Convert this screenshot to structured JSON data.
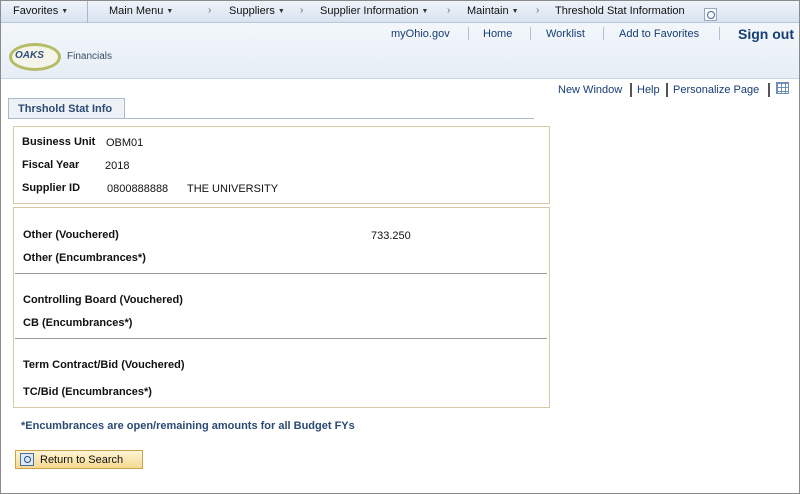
{
  "nav": {
    "favorites": "Favorites",
    "main_menu": "Main Menu",
    "breadcrumbs": [
      "Suppliers",
      "Supplier Information",
      "Maintain",
      "Threshold Stat Information"
    ],
    "dropdown_glyph": "▼",
    "arrow_glyph": "›"
  },
  "header": {
    "logo_text": "OAKS",
    "logo_subtext": "Financials",
    "links": [
      "myOhio.gov",
      "Home",
      "Worklist",
      "Add to Favorites"
    ],
    "sign_out": "Sign out"
  },
  "page_links": [
    "New Window",
    "Help",
    "Personalize Page"
  ],
  "tab": {
    "label": "Thrshold Stat Info"
  },
  "info": {
    "business_unit_label": "Business Unit",
    "business_unit_value": "OBM01",
    "fiscal_year_label": "Fiscal Year",
    "fiscal_year_value": "2018",
    "supplier_id_label": "Supplier ID",
    "supplier_id_value": "0800888888",
    "supplier_name": "THE UNIVERSITY"
  },
  "stats": {
    "other_vouchered_label": "Other (Vouchered)",
    "other_vouchered_value": "733.250",
    "other_encumbrances_label": "Other (Encumbrances*)",
    "cb_vouchered_label": "Controlling Board (Vouchered)",
    "cb_encumbrances_label": "CB (Encumbrances*)",
    "tc_vouchered_label": "Term Contract/Bid (Vouchered)",
    "tc_encumbrances_label": "TC/Bid (Encumbrances*)"
  },
  "footnote": "*Encumbrances are open/remaining amounts for all Budget FYs",
  "return_button": "Return to Search",
  "icons": {
    "search": "search-icon",
    "grid": "grid-icon",
    "return": "return-search-icon"
  },
  "colors": {
    "link": "#173d75",
    "nav_bg": "#d9e4f1",
    "box_border": "#d6c9a8",
    "button_bg": "#f5d98f"
  }
}
